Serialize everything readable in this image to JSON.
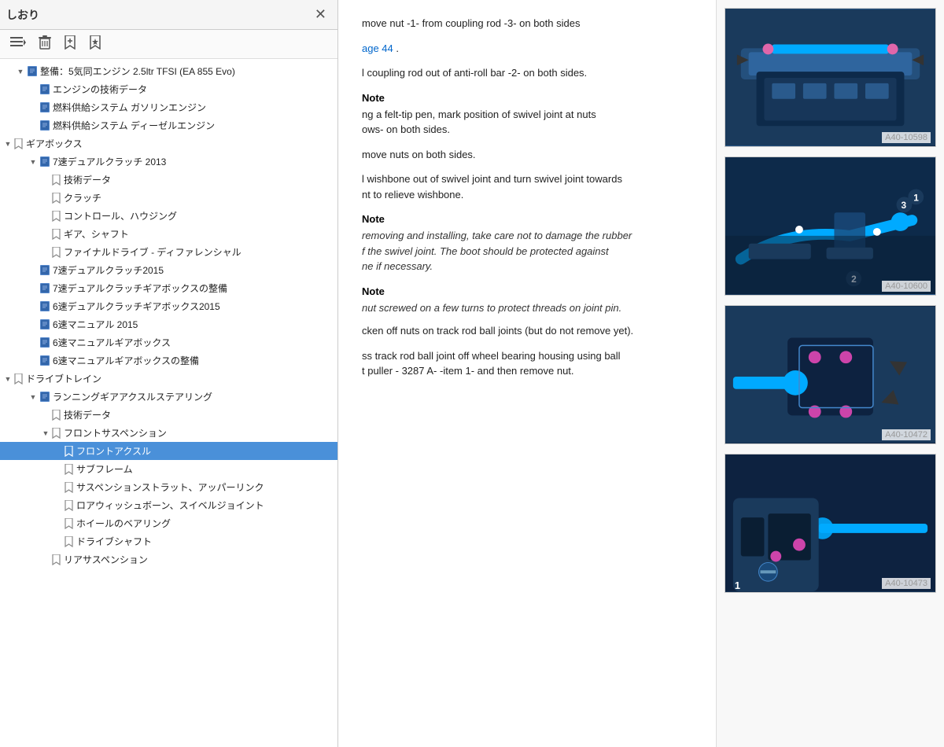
{
  "leftPanel": {
    "title": "しおり",
    "toolbar": {
      "menu_icon": "☰",
      "delete_icon": "🗑",
      "bookmark_add_icon": "🔖",
      "bookmark_star_icon": "★"
    },
    "treeItems": [
      {
        "id": "item-1",
        "label": "整備：5気同エンジン 2.5ltr TFSI (EA 855 Evo)",
        "indent": 1,
        "type": "doc",
        "expanded": true,
        "selected": false
      },
      {
        "id": "item-2",
        "label": "エンジンの技術データ",
        "indent": 2,
        "type": "doc",
        "selected": false
      },
      {
        "id": "item-3",
        "label": "燃料供給システム ガソリンエンジン",
        "indent": 2,
        "type": "doc",
        "selected": false
      },
      {
        "id": "item-4",
        "label": "燃料供給システム ディーゼルエンジン",
        "indent": 2,
        "type": "doc",
        "selected": false
      },
      {
        "id": "item-5",
        "label": "ギアボックス",
        "indent": 0,
        "type": "bookmark-section",
        "expanded": true,
        "selected": false
      },
      {
        "id": "item-6",
        "label": "7速デュアルクラッチ 2013",
        "indent": 2,
        "type": "doc",
        "expanded": true,
        "selected": false
      },
      {
        "id": "item-7",
        "label": "技術データ",
        "indent": 3,
        "type": "bookmark",
        "selected": false
      },
      {
        "id": "item-8",
        "label": "クラッチ",
        "indent": 3,
        "type": "bookmark",
        "selected": false
      },
      {
        "id": "item-9",
        "label": "コントロール、ハウジング",
        "indent": 3,
        "type": "bookmark",
        "selected": false
      },
      {
        "id": "item-10",
        "label": "ギア、シャフト",
        "indent": 3,
        "type": "bookmark",
        "selected": false
      },
      {
        "id": "item-11",
        "label": "ファイナルドライブ - ディファレンシャル",
        "indent": 3,
        "type": "bookmark",
        "selected": false
      },
      {
        "id": "item-12",
        "label": "7速デュアルクラッチ2015",
        "indent": 2,
        "type": "doc",
        "selected": false
      },
      {
        "id": "item-13",
        "label": "7速デュアルクラッチギアボックスの整備",
        "indent": 2,
        "type": "doc",
        "selected": false
      },
      {
        "id": "item-14",
        "label": "6速デュアルクラッチギアボックス2015",
        "indent": 2,
        "type": "doc",
        "selected": false
      },
      {
        "id": "item-15",
        "label": "6速マニュアル 2015",
        "indent": 2,
        "type": "doc",
        "selected": false
      },
      {
        "id": "item-16",
        "label": "6速マニュアルギアボックス",
        "indent": 2,
        "type": "doc",
        "selected": false
      },
      {
        "id": "item-17",
        "label": "6速マニュアルギアボックスの整備",
        "indent": 2,
        "type": "doc",
        "selected": false
      },
      {
        "id": "item-18",
        "label": "ドライブトレイン",
        "indent": 0,
        "type": "bookmark-section",
        "expanded": true,
        "selected": false
      },
      {
        "id": "item-19",
        "label": "ランニングギアアクスルステアリング",
        "indent": 2,
        "type": "doc",
        "expanded": true,
        "selected": false
      },
      {
        "id": "item-20",
        "label": "技術データ",
        "indent": 3,
        "type": "bookmark",
        "selected": false
      },
      {
        "id": "item-21",
        "label": "フロントサスペンション",
        "indent": 3,
        "type": "bookmark",
        "expanded": true,
        "selected": false
      },
      {
        "id": "item-22",
        "label": "フロントアクスル",
        "indent": 4,
        "type": "bookmark",
        "selected": true
      },
      {
        "id": "item-23",
        "label": "サブフレーム",
        "indent": 4,
        "type": "bookmark",
        "selected": false
      },
      {
        "id": "item-24",
        "label": "サスペンションストラット、アッパーリンク",
        "indent": 4,
        "type": "bookmark",
        "selected": false
      },
      {
        "id": "item-25",
        "label": "ロアウィッシュボーン、スイベルジョイント",
        "indent": 4,
        "type": "bookmark",
        "selected": false
      },
      {
        "id": "item-26",
        "label": "ホイールのベアリング",
        "indent": 4,
        "type": "bookmark",
        "selected": false
      },
      {
        "id": "item-27",
        "label": "ドライブシャフト",
        "indent": 4,
        "type": "bookmark",
        "selected": false
      },
      {
        "id": "item-28",
        "label": "リアサスペンション",
        "indent": 3,
        "type": "bookmark",
        "selected": false
      }
    ]
  },
  "rightPanel": {
    "steps": [
      {
        "id": "step-1",
        "text": "move nut -1- from coupling rod -3- on both sides"
      },
      {
        "id": "step-2",
        "text": "age 44",
        "isLink": false,
        "linkText": "age 44"
      },
      {
        "id": "step-3",
        "text": "l coupling rod out of anti-roll bar -2- on both sides."
      }
    ],
    "notes": [
      {
        "id": "note-1",
        "label": "Note",
        "text": "ng a felt-tip pen, mark position of swivel joint at nuts\nows- on both sides."
      },
      {
        "id": "note-2",
        "text": "move nuts on both sides."
      },
      {
        "id": "note-3",
        "text": "l wishbone out of swivel joint and turn swivel joint towards\nnt to relieve wishbone."
      },
      {
        "id": "note-4",
        "label": "Note",
        "text": "removing and installing, take care not to damage the rubber\nf the swivel joint. The boot should be protected against\nne if necessary."
      },
      {
        "id": "note-5",
        "label": "Note",
        "text": "nut screwed on a few turns to protect threads on joint pin."
      },
      {
        "id": "note-6",
        "text": "cken off nuts on track rod ball joints (but do not remove yet)."
      },
      {
        "id": "note-7",
        "text": "ss track rod ball joint off wheel bearing housing using ball\nt puller - 3287 A- -item 1- and then remove nut."
      }
    ],
    "images": [
      {
        "id": "img-1",
        "label": "A40-10598",
        "alt": "Engine component diagram 1"
      },
      {
        "id": "img-2",
        "label": "A40-10600",
        "alt": "Anti-roll bar coupling rod diagram"
      },
      {
        "id": "img-3",
        "label": "A40-10472",
        "alt": "Swivel joint diagram"
      },
      {
        "id": "img-4",
        "label": "A40-10473",
        "alt": "Track rod ball joint diagram"
      }
    ],
    "imageNumbers": {
      "img2": [
        "1",
        "2",
        "3"
      ],
      "img4": [
        "1"
      ]
    }
  }
}
